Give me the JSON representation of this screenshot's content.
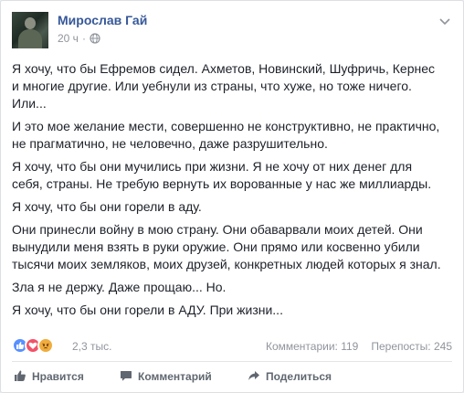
{
  "post": {
    "author": "Мирослав Гай",
    "time": "20 ч",
    "separator": "·",
    "paragraphs": [
      "Я хочу, что бы Ефремов сидел. Ахметов, Новинский, Шуфричь, Кернес\nи многие другие. Или уебнули из страны, что хуже, но тоже ничего.\nИли...",
      "И это мое желание мести, совершенно не конструктивно, не практично,\nне прагматично, не человечно, даже разрушительно.",
      "Я хочу, что бы они мучились при жизни. Я не хочу от них денег для\nсебя, страны. Не требую вернуть их ворованные у нас же миллиарды.",
      "Я хочу, что бы они горели в аду.",
      "Они принесли войну в мою страну. Они обаварвали моих детей. Они\nвынудили меня взять в руки оружие. Они прямо или косвенно убили\nтысячи моих земляков, моих друзей, конкретных людей которых я знал.",
      "Зла я не держу. Даже прощаю... Но.",
      "Я хочу, что бы они горели в АДУ. При жизни..."
    ]
  },
  "reactions": {
    "icons": [
      "like-reaction",
      "love-reaction",
      "angry-reaction"
    ],
    "count": "2,3 тыс.",
    "comments": "Комментарии: 119",
    "shares": "Перепосты: 245"
  },
  "actions": {
    "like": "Нравится",
    "comment": "Комментарий",
    "share": "Поделиться"
  },
  "colors": {
    "author": "#365899",
    "meta": "#90949c",
    "like": "#5890ff",
    "love": "#f25268",
    "angry": "#f0ac3d"
  }
}
